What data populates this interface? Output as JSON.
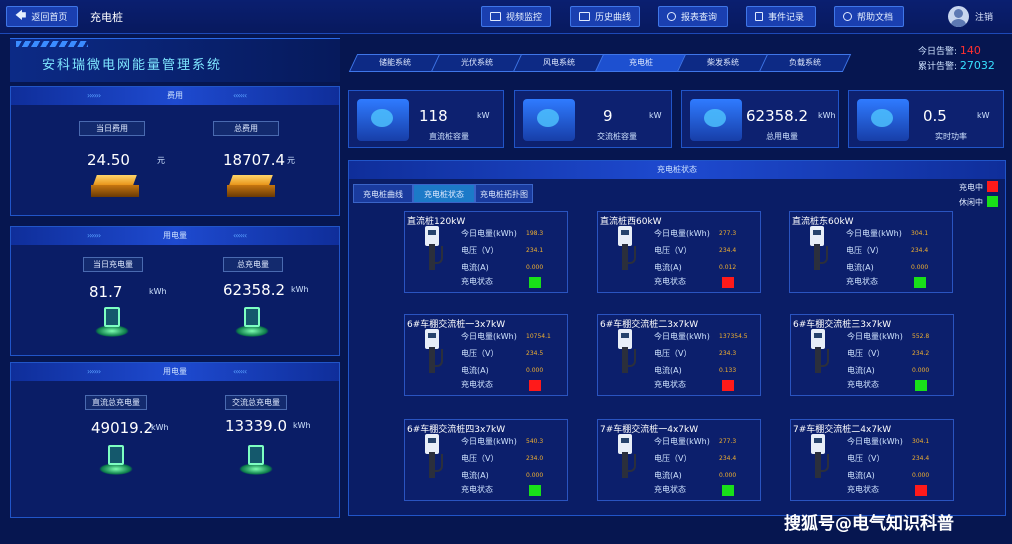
{
  "topbar": {
    "back_label": "返回首页",
    "page_name": "充电桩",
    "buttons": [
      "视频监控",
      "历史曲线",
      "报表查询",
      "事件记录",
      "帮助文档"
    ],
    "logout_label": "注销"
  },
  "header": {
    "system_title": "安科瑞微电网能量管理系统",
    "nav_tabs": [
      "储能系统",
      "光伏系统",
      "风电系统",
      "充电桩",
      "柴发系统",
      "负载系统"
    ],
    "active_tab": "充电桩",
    "alarm_today_label": "今日告警:",
    "alarm_today_value": "140",
    "alarm_total_label": "累计告警:",
    "alarm_total_value": "27032"
  },
  "left": {
    "cost": {
      "title": "费用",
      "today_label": "当日费用",
      "today_value": "24.50",
      "today_unit": "元",
      "total_label": "总费用",
      "total_value": "18707.4",
      "total_unit": "元"
    },
    "energy": {
      "title": "用电量",
      "today_label": "当日充电量",
      "today_value": "81.7",
      "today_unit": "kWh",
      "total_label": "总充电量",
      "total_value": "62358.2",
      "total_unit": "kWh"
    },
    "energy2": {
      "title": "用电量",
      "dc_label": "直流总充电量",
      "dc_value": "49019.2",
      "dc_unit": "kWh",
      "ac_label": "交流总充电量",
      "ac_value": "13339.0",
      "ac_unit": "kWh"
    }
  },
  "stats": [
    {
      "value": "118",
      "unit": "kW",
      "label": "直流桩容量"
    },
    {
      "value": "9",
      "unit": "kW",
      "label": "交流桩容量"
    },
    {
      "value": "62358.2",
      "unit": "kWh",
      "label": "总用电量"
    },
    {
      "value": "0.5",
      "unit": "kW",
      "label": "实时功率"
    }
  ],
  "main": {
    "title": "充电桩状态",
    "subtabs": [
      "充电桩曲线",
      "充电桩状态",
      "充电桩拓扑图"
    ],
    "active_subtab": "充电桩状态",
    "legend": [
      {
        "label": "充电中",
        "color": "#ff1a1a"
      },
      {
        "label": "休闲中",
        "color": "#19e019"
      }
    ],
    "row_labels": {
      "energy": "今日电量(kWh)",
      "voltage": "电压（V）",
      "current": "电流(A)",
      "status": "充电状态"
    },
    "chargers": [
      {
        "name": "直流桩120kW",
        "energy": "198.3",
        "voltage": "234.1",
        "current": "0.000",
        "status_color": "#19e019"
      },
      {
        "name": "直流桩西60kW",
        "energy": "277.3",
        "voltage": "234.4",
        "current": "0.012",
        "status_color": "#ff1a1a"
      },
      {
        "name": "直流桩东60kW",
        "energy": "304.1",
        "voltage": "234.4",
        "current": "0.000",
        "status_color": "#19e019"
      },
      {
        "name": "6#车棚交流桩一3x7kW",
        "energy": "10754.1",
        "voltage": "234.5",
        "current": "0.000",
        "status_color": "#ff1a1a"
      },
      {
        "name": "6#车棚交流桩二3x7kW",
        "energy": "137354.5",
        "voltage": "234.3",
        "current": "0.133",
        "status_color": "#ff1a1a"
      },
      {
        "name": "6#车棚交流桩三3x7kW",
        "energy": "552.8",
        "voltage": "234.2",
        "current": "0.000",
        "status_color": "#19e019"
      },
      {
        "name": "6#车棚交流桩四3x7kW",
        "energy": "540.3",
        "voltage": "234.0",
        "current": "0.000",
        "status_color": "#19e019"
      },
      {
        "name": "7#车棚交流桩一4x7kW",
        "energy": "277.3",
        "voltage": "234.4",
        "current": "0.000",
        "status_color": "#19e019"
      },
      {
        "name": "7#车棚交流桩二4x7kW",
        "energy": "304.1",
        "voltage": "234.4",
        "current": "0.000",
        "status_color": "#ff1a1a"
      }
    ]
  },
  "watermark": "搜狐号@电气知识科普"
}
